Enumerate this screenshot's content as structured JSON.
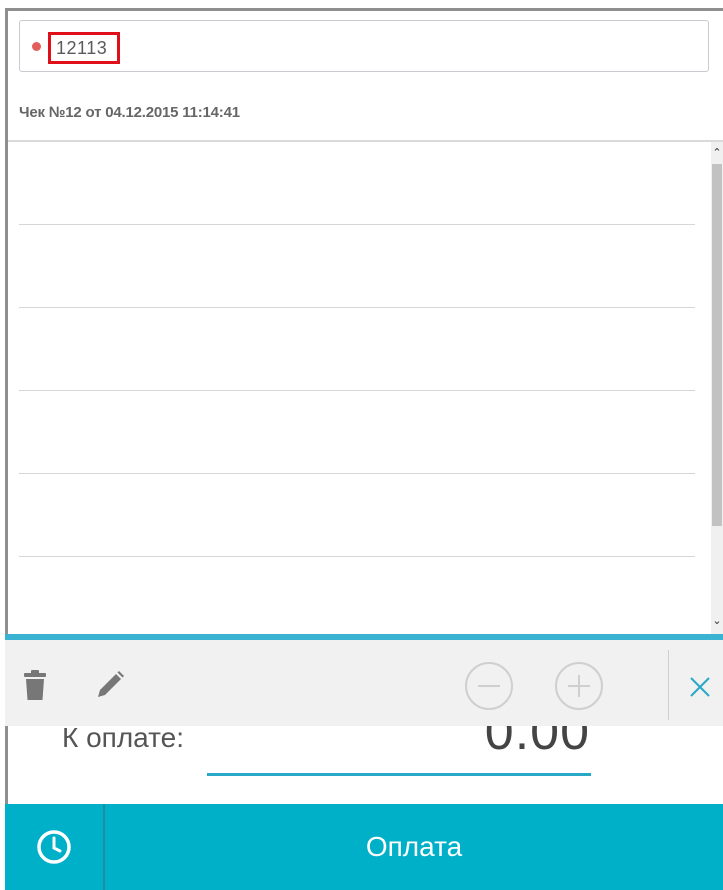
{
  "search": {
    "value": "12113",
    "status_color": "#e35d5d"
  },
  "receipt": {
    "title": "Чек №12 от 04.12.2015 11:14:41"
  },
  "list": {
    "rows": 5
  },
  "toolbar": {
    "icons": [
      "trash-icon",
      "pencil-icon",
      "minus-icon",
      "plus-icon",
      "close-icon"
    ],
    "accent_color": "#3ab2d2"
  },
  "total": {
    "label": "К оплате:",
    "value": "0.00"
  },
  "footer": {
    "history_icon": "clock-icon",
    "pay_label": "Оплата",
    "bar_color": "#00b0c8"
  }
}
